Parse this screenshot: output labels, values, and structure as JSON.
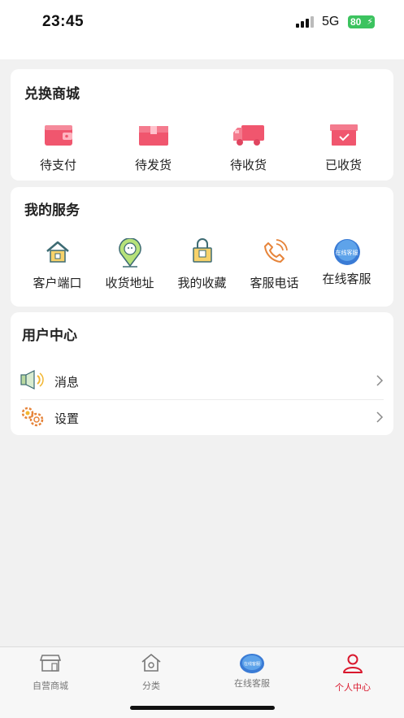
{
  "status_bar": {
    "time": "23:45",
    "network": "5G",
    "battery": "80"
  },
  "exchange_mall": {
    "title": "兑换商城",
    "items": [
      {
        "label": "待支付",
        "icon": "wallet-icon"
      },
      {
        "label": "待发货",
        "icon": "package-icon"
      },
      {
        "label": "待收货",
        "icon": "truck-icon"
      },
      {
        "label": "已收货",
        "icon": "received-box-icon"
      }
    ]
  },
  "my_services": {
    "title": "我的服务",
    "items": [
      {
        "label": "客户端口",
        "icon": "house-icon"
      },
      {
        "label": "收货地址",
        "icon": "location-pin-icon"
      },
      {
        "label": "我的收藏",
        "icon": "bag-icon"
      },
      {
        "label": "客服电话",
        "icon": "phone-icon"
      },
      {
        "label": "在线客服",
        "icon": "chat-bubble-icon",
        "badge": "在线客服"
      }
    ]
  },
  "user_center": {
    "title": "用户中心",
    "rows": [
      {
        "label": "消息",
        "icon": "speaker-icon"
      },
      {
        "label": "设置",
        "icon": "gears-icon"
      }
    ]
  },
  "tab_bar": {
    "tabs": [
      {
        "label": "自营商城",
        "icon": "shop-icon"
      },
      {
        "label": "分类",
        "icon": "home-icon"
      },
      {
        "label": "在线客服",
        "icon": "chat-bubble-icon",
        "badge": "在线客服"
      },
      {
        "label": "个人中心",
        "icon": "person-icon",
        "active": true
      }
    ]
  },
  "colors": {
    "accent": "#d9182d",
    "mall_icon": "#f0566e",
    "service_orange": "#e6843a"
  }
}
